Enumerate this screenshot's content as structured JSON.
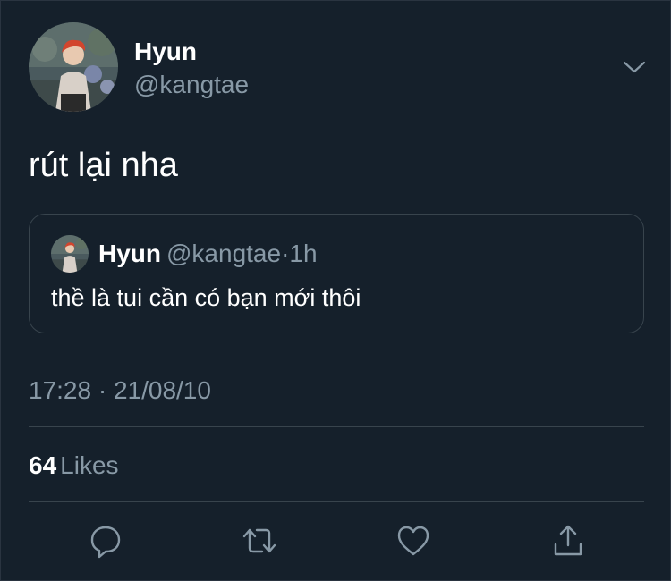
{
  "tweet": {
    "author": {
      "name": "Hyun",
      "handle": "@kangtae"
    },
    "text": "rút lại nha",
    "timestamp": "17:28 · 21/08/10",
    "likes": {
      "count": "64",
      "label": "Likes"
    }
  },
  "quoted_tweet": {
    "author": {
      "name": "Hyun",
      "handle": "@kangtae"
    },
    "separator": "·",
    "time": "1h",
    "text": "thề là tui cần có bạn mới thôi"
  },
  "icons": {
    "more": "chevron-down-icon",
    "reply": "reply-icon",
    "retweet": "retweet-icon",
    "like": "heart-icon",
    "share": "share-icon"
  },
  "colors": {
    "background": "#15202b",
    "primary_text": "#ffffff",
    "secondary_text": "#8899a6",
    "border": "#38444d"
  }
}
